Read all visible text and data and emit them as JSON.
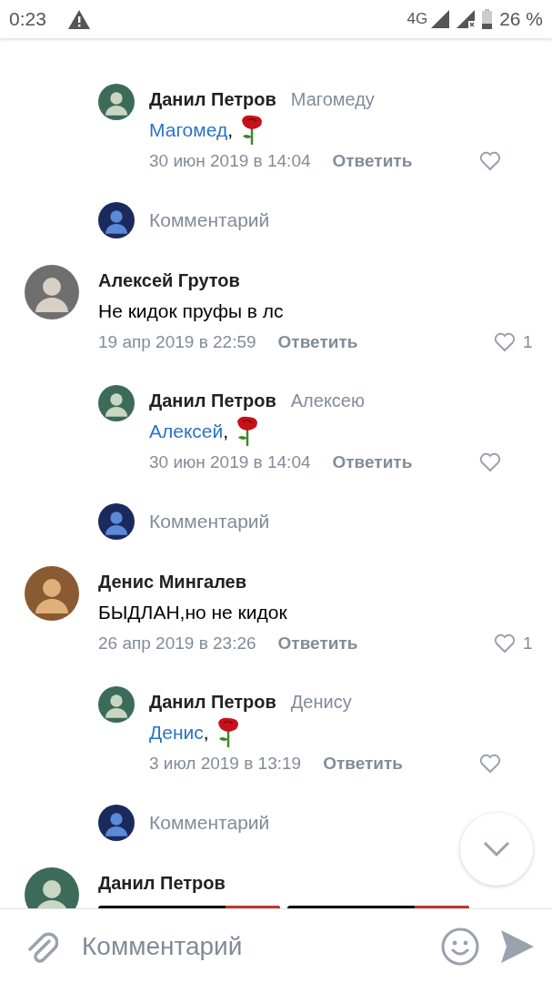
{
  "status_bar": {
    "time": "0:23",
    "network": "4G",
    "battery": "26 %"
  },
  "items": [
    {
      "kind": "reply",
      "author": "Данил Петров",
      "addressee": "Магомеду",
      "mention": "Магомед",
      "text": ",",
      "date": "30 июн 2019 в 14:04",
      "reply_label": "Ответить"
    },
    {
      "kind": "compose",
      "label": "Комментарий"
    },
    {
      "kind": "comment",
      "author": "Алексей Грутов",
      "text": "Не кидок пруфы в лс",
      "date": "19 апр 2019 в 22:59",
      "reply_label": "Ответить",
      "likes": "1"
    },
    {
      "kind": "reply",
      "author": "Данил Петров",
      "addressee": "Алексею",
      "mention": "Алексей",
      "text": ",",
      "date": "30 июн 2019 в 14:04",
      "reply_label": "Ответить"
    },
    {
      "kind": "compose",
      "label": "Комментарий"
    },
    {
      "kind": "comment",
      "author": "Денис Мингалев",
      "text": "БЫДЛАН,но не кидок",
      "date": "26 апр 2019 в 23:26",
      "reply_label": "Ответить",
      "likes": "1"
    },
    {
      "kind": "reply",
      "author": "Данил Петров",
      "addressee": "Денису",
      "mention": "Денис",
      "text": ",",
      "date": "3 июл 2019 в 13:19",
      "reply_label": "Ответить"
    },
    {
      "kind": "compose",
      "label": "Комментарий"
    },
    {
      "kind": "comment",
      "author": "Данил Петров"
    }
  ],
  "composer": {
    "placeholder": "Комментарий"
  }
}
